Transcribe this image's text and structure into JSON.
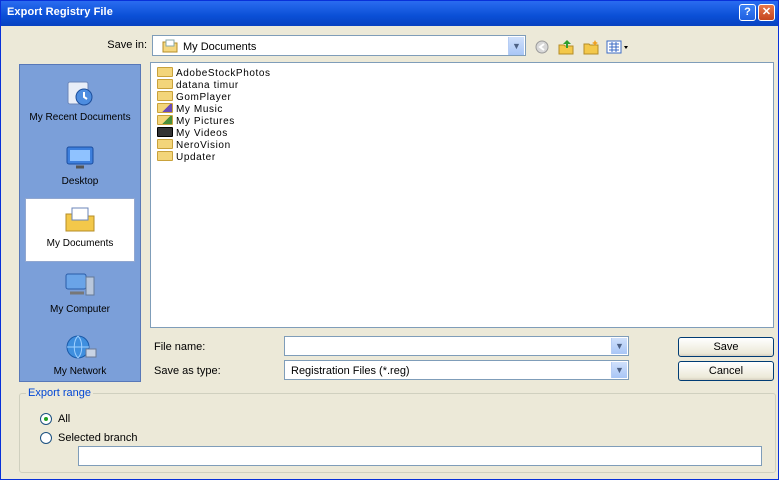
{
  "window": {
    "title": "Export Registry File",
    "help_glyph": "?",
    "close_glyph": "✕"
  },
  "save_in": {
    "label": "Save in:",
    "value": "My Documents"
  },
  "toolbar": {
    "back_icon": "back-icon",
    "up_icon": "up-folder-icon",
    "new_folder_icon": "new-folder-icon",
    "views_icon": "views-menu-icon"
  },
  "places": [
    {
      "label": "My Recent Documents",
      "icon": "recent-documents-icon",
      "selected": false
    },
    {
      "label": "Desktop",
      "icon": "desktop-icon",
      "selected": false
    },
    {
      "label": "My Documents",
      "icon": "my-documents-icon",
      "selected": true
    },
    {
      "label": "My Computer",
      "icon": "my-computer-icon",
      "selected": false
    },
    {
      "label": "My Network",
      "icon": "my-network-icon",
      "selected": false
    }
  ],
  "files": [
    {
      "name": "AdobeStockPhotos",
      "icon": "folder-icon"
    },
    {
      "name": "datana timur",
      "icon": "folder-icon"
    },
    {
      "name": "GomPlayer",
      "icon": "folder-icon"
    },
    {
      "name": "My Music",
      "icon": "music-folder-icon"
    },
    {
      "name": "My Pictures",
      "icon": "pictures-folder-icon"
    },
    {
      "name": "My Videos",
      "icon": "videos-folder-icon"
    },
    {
      "name": "NeroVision",
      "icon": "folder-icon"
    },
    {
      "name": "Updater",
      "icon": "folder-icon"
    }
  ],
  "file_name": {
    "label": "File name:",
    "value": ""
  },
  "save_as_type": {
    "label": "Save as type:",
    "value": "Registration Files (*.reg)"
  },
  "buttons": {
    "save": "Save",
    "cancel": "Cancel"
  },
  "export_range": {
    "legend": "Export range",
    "options": [
      {
        "label": "All",
        "checked": true
      },
      {
        "label": "Selected branch",
        "checked": false
      }
    ],
    "branch_value": ""
  }
}
